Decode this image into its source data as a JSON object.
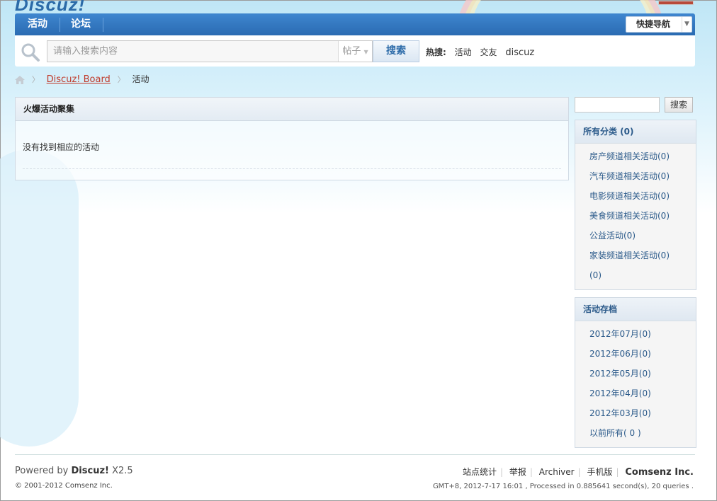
{
  "brand": {
    "logo_text": "Discuz!"
  },
  "nav": {
    "items": [
      {
        "label": "活动"
      },
      {
        "label": "论坛"
      }
    ],
    "quicknav_label": "快捷导航"
  },
  "search": {
    "placeholder": "请输入搜索内容",
    "type_label": "帖子",
    "button_label": "搜索",
    "hot_label": "热搜:",
    "hot_terms": [
      "活动",
      "交友",
      "discuz"
    ]
  },
  "breadcrumb": {
    "link_label": "Discuz! Board",
    "current": "活动"
  },
  "main": {
    "title": "火爆活动聚集",
    "empty_text": "没有找到相应的活动"
  },
  "sidebar": {
    "search_button_label": "搜索",
    "categories": {
      "title": "所有分类 (0)",
      "items": [
        "房产频道相关活动(0)",
        "汽车频道相关活动(0)",
        "电影频道相关活动(0)",
        "美食频道相关活动(0)",
        "公益活动(0)",
        "家装频道相关活动(0)",
        "(0)"
      ]
    },
    "archive": {
      "title": "活动存档",
      "items": [
        "2012年07月(0)",
        "2012年06月(0)",
        "2012年05月(0)",
        "2012年04月(0)",
        "2012年03月(0)",
        "以前所有( 0 )"
      ]
    }
  },
  "footer": {
    "powered_prefix": "Powered by",
    "powered_brand": "Discuz!",
    "powered_version": "X2.5",
    "copyright": "© 2001-2012 Comsenz Inc.",
    "links": [
      "站点统计",
      "举报",
      "Archiver",
      "手机版"
    ],
    "company": "Comsenz Inc.",
    "stats": "GMT+8, 2012-7-17 16:01 , Processed in 0.885641 second(s), 20 queries ."
  },
  "colors": {
    "nav_blue": "#2a6bb2",
    "link_red": "#c03a2b",
    "sidebar_text": "#2b5a8a"
  }
}
